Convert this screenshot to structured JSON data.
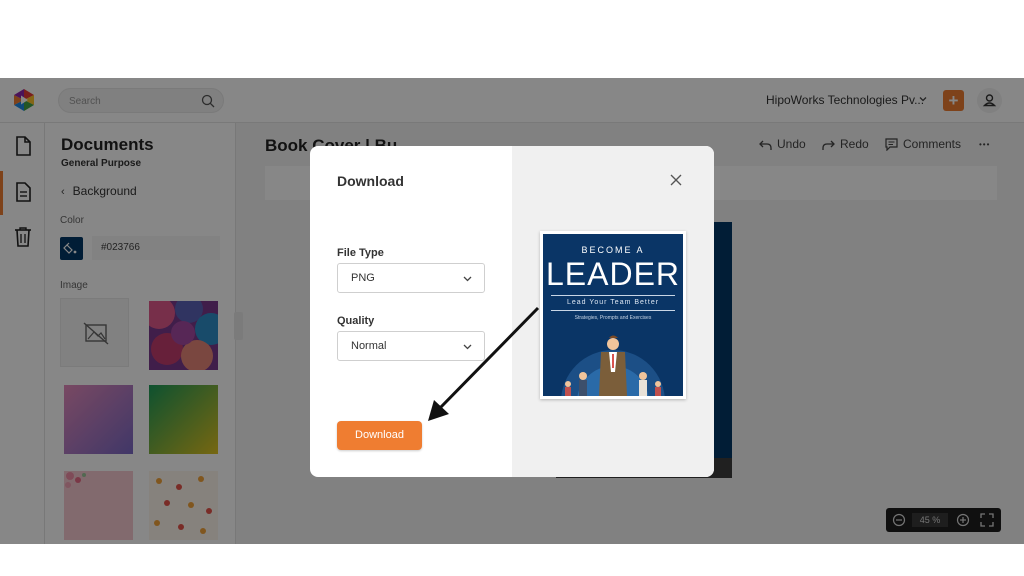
{
  "topbar": {
    "search_placeholder": "Search",
    "org_name": "HipoWorks Technologies Pv...",
    "plus_label": "+"
  },
  "panel": {
    "title": "Documents",
    "subtitle": "General Purpose",
    "back_label": "Background",
    "color_label": "Color",
    "color_hex": "#023766",
    "image_label": "Image"
  },
  "editor": {
    "doc_title": "Book Cover | Bu",
    "undo": "Undo",
    "redo": "Redo",
    "comments": "Comments",
    "more": "•••",
    "zoom_value": "45 %"
  },
  "modal": {
    "title": "Download",
    "file_type_label": "File Type",
    "file_type_value": "PNG",
    "quality_label": "Quality",
    "quality_value": "Normal",
    "download_label": "Download",
    "cover": {
      "line1": "BECOME A",
      "line2": "LEADER",
      "line3": "Lead Your Team Better",
      "line4": "Strategies, Prompts and Exercises"
    }
  },
  "colors": {
    "accent": "#ef7d31",
    "cover_bg": "#023766"
  }
}
